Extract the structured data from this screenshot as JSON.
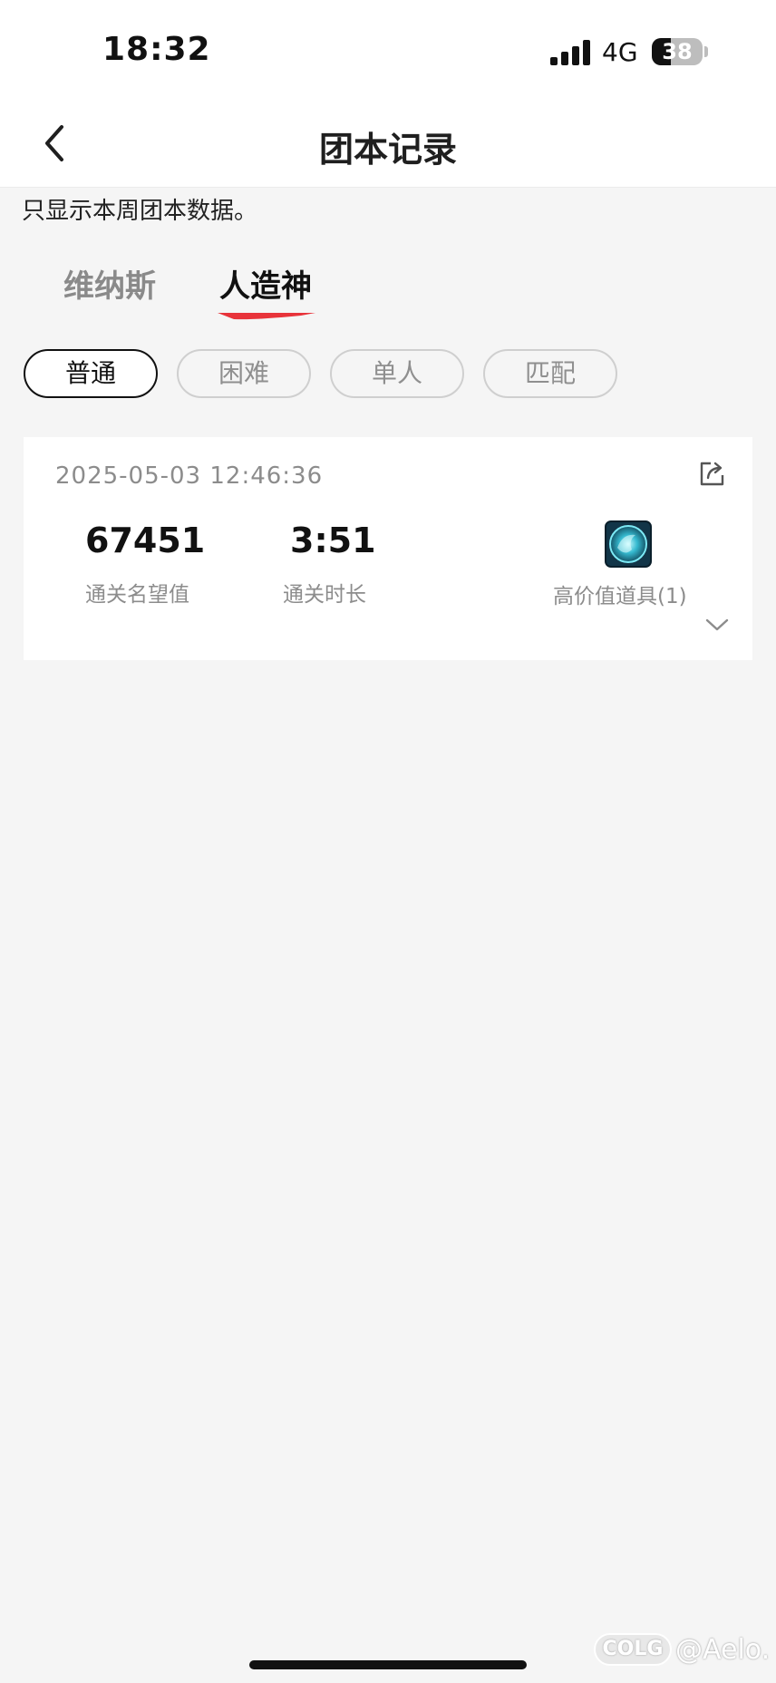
{
  "status_bar": {
    "time": "18:32",
    "network": "4G",
    "battery": "38",
    "battery_level": 38
  },
  "header": {
    "title": "团本记录"
  },
  "notice": "只显示本周团本数据。",
  "tabs": [
    {
      "label": "维纳斯",
      "active": false
    },
    {
      "label": "人造神",
      "active": true
    }
  ],
  "filters": [
    {
      "label": "普通",
      "active": true
    },
    {
      "label": "困难",
      "active": false
    },
    {
      "label": "单人",
      "active": false
    },
    {
      "label": "匹配",
      "active": false
    }
  ],
  "record": {
    "datetime": "2025-05-03 12:46:36",
    "reputation_value": "67451",
    "reputation_label": "通关名望值",
    "duration_value": "3:51",
    "duration_label": "通关时长",
    "item_label": "高价值道具(1)"
  },
  "watermark": {
    "logo": "COLG",
    "text": "@Aelo."
  },
  "colors": {
    "accent": "#e8333a",
    "background": "#f5f5f5",
    "card": "#ffffff",
    "text_secondary": "#8c8c8c"
  }
}
